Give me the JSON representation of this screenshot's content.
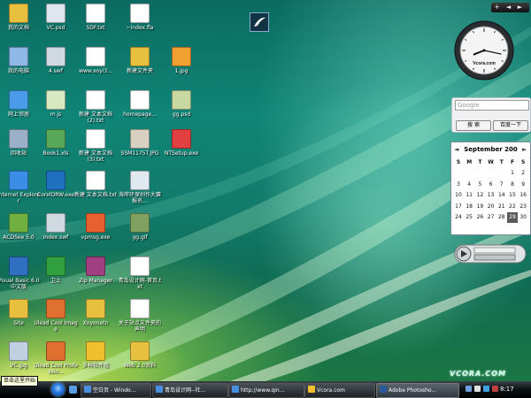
{
  "desktop_icons": [
    {
      "name": "我的文档",
      "color": "#e8c040",
      "col": 0,
      "row": 0
    },
    {
      "name": "VC.psd",
      "color": "#dfe6ee",
      "col": 1,
      "row": 0
    },
    {
      "name": "SDF.txt",
      "color": "#ffffff",
      "col": 2,
      "row": 0
    },
    {
      "name": "~index.fla",
      "color": "#ffffff",
      "col": 3,
      "row": 0
    },
    {
      "name": "我的电脑",
      "color": "#8fb8e8",
      "col": 0,
      "row": 1
    },
    {
      "name": "4.swf",
      "color": "#d0d8e0",
      "col": 1,
      "row": 1
    },
    {
      "name": "www.xoyi3...",
      "color": "#ffffff",
      "col": 2,
      "row": 1
    },
    {
      "name": "新建文件夹",
      "color": "#e8c040",
      "col": 3,
      "row": 1
    },
    {
      "name": "1.jpg",
      "color": "#f0a030",
      "col": 4,
      "row": 1
    },
    {
      "name": "网上邻居",
      "color": "#4a9be8",
      "col": 0,
      "row": 2
    },
    {
      "name": "m.js",
      "color": "#d8e8c0",
      "col": 1,
      "row": 2
    },
    {
      "name": "新建 文本文档 (2).txt",
      "color": "#ffffff",
      "col": 2,
      "row": 2
    },
    {
      "name": "homepage...",
      "color": "#ffffff",
      "col": 3,
      "row": 2
    },
    {
      "name": "gg.psd",
      "color": "#c8d8a0",
      "col": 4,
      "row": 2
    },
    {
      "name": "回收站",
      "color": "#9ab0c8",
      "col": 0,
      "row": 3
    },
    {
      "name": "Book1.xls",
      "color": "#58a858",
      "col": 1,
      "row": 3
    },
    {
      "name": "新建 文本文档 (3).txt",
      "color": "#ffffff",
      "col": 2,
      "row": 3
    },
    {
      "name": "SSM1175T.JPG",
      "color": "#d8d0c0",
      "col": 3,
      "row": 3
    },
    {
      "name": "NTSetup.exe",
      "color": "#e04040",
      "col": 4,
      "row": 3
    },
    {
      "name": "Internet Explorer",
      "color": "#3a8ee6",
      "col": 0,
      "row": 4
    },
    {
      "name": "CorelDRW.exe",
      "color": "#2070c0",
      "col": 1,
      "row": 4
    },
    {
      "name": "新建 文本文档.txt",
      "color": "#ffffff",
      "col": 2,
      "row": 4
    },
    {
      "name": "海岸环保创作大赛报名...",
      "color": "#e0e8f0",
      "col": 3,
      "row": 4
    },
    {
      "name": "ACDSee 5.0",
      "color": "#70b040",
      "col": 0,
      "row": 5
    },
    {
      "name": "index.swf",
      "color": "#d0d8e0",
      "col": 1,
      "row": 5
    },
    {
      "name": "vpmsg.exe",
      "color": "#e86030",
      "col": 2,
      "row": 5
    },
    {
      "name": "gg.gif",
      "color": "#80a060",
      "col": 3,
      "row": 5
    },
    {
      "name": "Visual Basic 6.0 中文版",
      "color": "#3070c0",
      "col": 0,
      "row": 6
    },
    {
      "name": "卫士",
      "color": "#30a040",
      "col": 1,
      "row": 6
    },
    {
      "name": "Zip Manager",
      "color": "#a04080",
      "col": 2,
      "row": 6
    },
    {
      "name": "青岛设计网-首页.txt",
      "color": "#ffffff",
      "col": 3,
      "row": 6
    },
    {
      "name": "Site",
      "color": "#e8c040",
      "col": 0,
      "row": 7
    },
    {
      "name": "Ulead Cool Image",
      "color": "#e07030",
      "col": 1,
      "row": 7
    },
    {
      "name": "Xoyonetn",
      "color": "#e8c040",
      "col": 2,
      "row": 7
    },
    {
      "name": "关于站点文件夹的声明",
      "color": "#ffffff",
      "col": 3,
      "row": 7
    },
    {
      "name": "VC.jpg",
      "color": "#c0d0e0",
      "col": 0,
      "row": 8
    },
    {
      "name": "Ulead Cool Professio...",
      "color": "#e07030",
      "col": 1,
      "row": 8
    },
    {
      "name": "多种软件组",
      "color": "#f0c030",
      "col": 2,
      "row": 8
    },
    {
      "name": "Web 2.0资料",
      "color": "#e8c040",
      "col": 3,
      "row": 8
    }
  ],
  "gadgets": {
    "clock_brand": "Vcora.com",
    "clock_time": {
      "hour": 8,
      "minute": 17
    },
    "google": {
      "placeholder": "Google",
      "search_button": "搜 索",
      "baidu_button": "百度一下"
    },
    "calendar": {
      "month_label": "September 200",
      "weekdays": [
        "S",
        "M",
        "T",
        "W",
        "T",
        "F",
        "S"
      ],
      "days": [
        1,
        2,
        3,
        4,
        5,
        6,
        7,
        8,
        9,
        10,
        11,
        12,
        13,
        14,
        15,
        16,
        17,
        18,
        19,
        20,
        21,
        22,
        23,
        24,
        25,
        26,
        27,
        28,
        29,
        30
      ],
      "first_weekday": 5,
      "today": 29
    }
  },
  "sidebar_controls": {
    "add": "+",
    "prev": "◄",
    "next": "►"
  },
  "brand_logo": "VCORA.COM",
  "start_tooltip": "单击这里开始",
  "taskbar": {
    "tasks": [
      {
        "label": "空白页 - Windo...",
        "color": "#4a90e0",
        "active": false
      },
      {
        "label": "青岛设计网--社...",
        "color": "#4a90e0",
        "active": false
      },
      {
        "label": "http://www.qin...",
        "color": "#4a90e0",
        "active": false
      },
      {
        "label": "Vcora.com",
        "color": "#f0c030",
        "active": false
      },
      {
        "label": "Adobe Photosho...",
        "color": "#2a5a9a",
        "active": true
      }
    ],
    "clock": "8:17"
  }
}
